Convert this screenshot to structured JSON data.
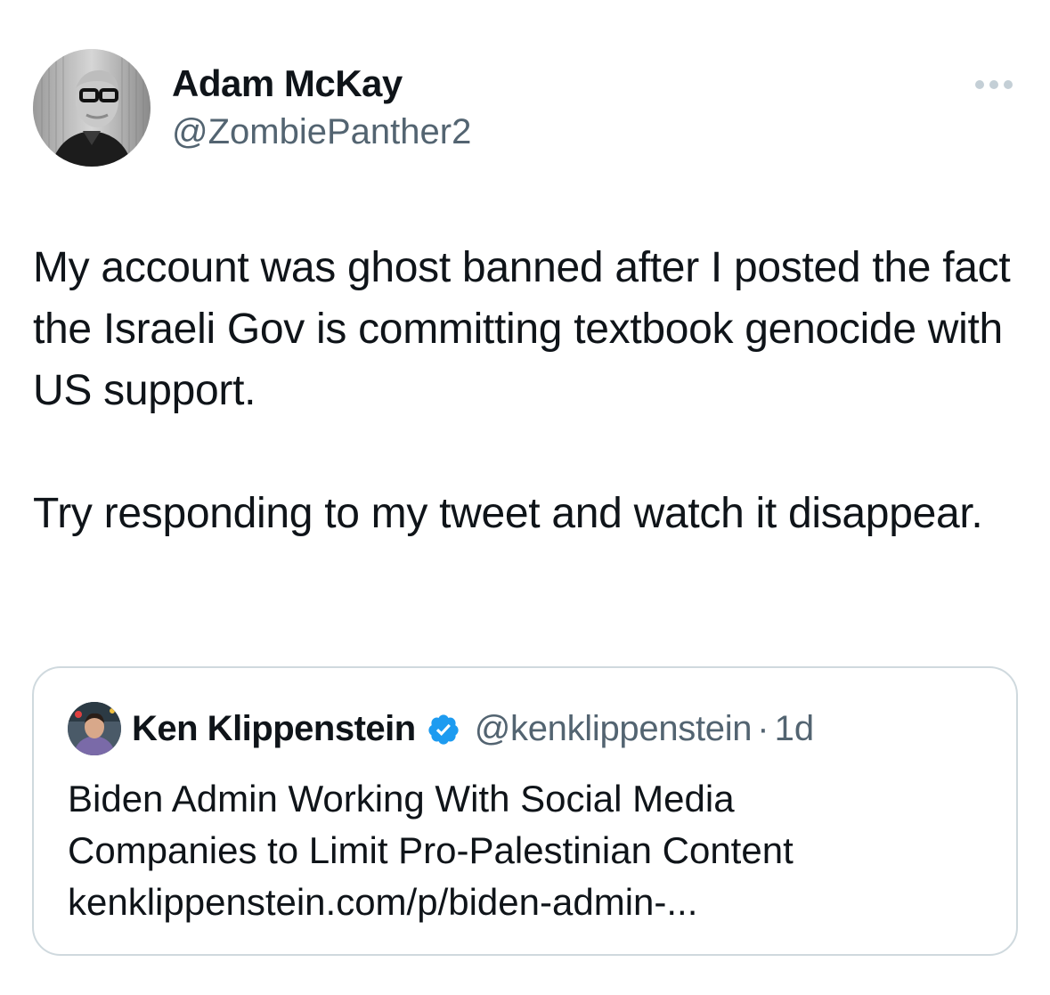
{
  "author": {
    "name": "Adam McKay",
    "handle": "@ZombiePanther2",
    "avatar": "avatar-portrait"
  },
  "more_icon": "more-horizontal-icon",
  "tweet": {
    "paragraphs": [
      "My account was ghost banned after I posted the fact the Israeli Gov is committing textbook genocide with US support.",
      "Try responding to my tweet and watch it disappear."
    ]
  },
  "quoted_tweet": {
    "author_name": "Ken Klippenstein",
    "verified_icon": "verified-badge-icon",
    "handle": "@kenklippenstein",
    "separator": "·",
    "time": "1d",
    "text_lines": [
      "Biden Admin Working With Social Media",
      "Companies to Limit Pro-Palestinian Content",
      "kenklippenstein.com/p/biden-admin-..."
    ]
  },
  "colors": {
    "text_primary": "#0f1419",
    "text_secondary": "#536471",
    "border": "#cfd9de",
    "verified_blue": "#1d9bf0"
  }
}
